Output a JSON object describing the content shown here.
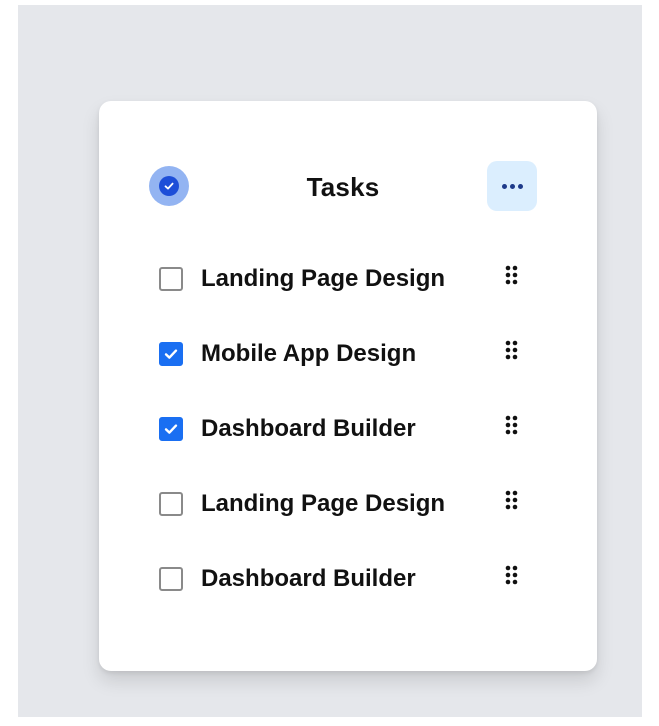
{
  "card": {
    "title": "Tasks",
    "header_icon": "check-circle-icon",
    "more_icon": "more-horizontal-icon"
  },
  "tasks": [
    {
      "label": "Landing Page Design",
      "checked": false
    },
    {
      "label": "Mobile App Design",
      "checked": true
    },
    {
      "label": "Dashboard Builder",
      "checked": true
    },
    {
      "label": "Landing Page Design",
      "checked": false
    },
    {
      "label": "Dashboard Builder",
      "checked": false
    }
  ],
  "colors": {
    "background": "#e5e7eb",
    "accent": "#1a6ff2",
    "header_icon_bg": "#93b4f2",
    "more_button_bg": "#dbeefe"
  }
}
